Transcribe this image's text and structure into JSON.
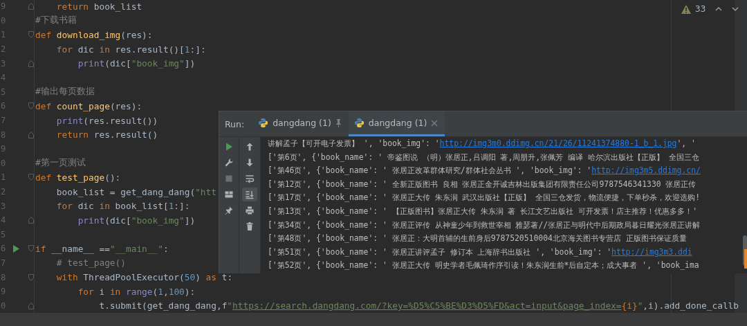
{
  "editor": {
    "lines": [
      {
        "number": "9",
        "run": false,
        "fold": {
          "kind": "end"
        },
        "tokens": [
          {
            "kind": "kw",
            "text": "    return"
          },
          {
            "kind": "p",
            "text": " book_list"
          }
        ]
      },
      {
        "number": "0",
        "run": false,
        "tokens": [
          {
            "kind": "cm",
            "text": "#下载书籍"
          }
        ]
      },
      {
        "number": "1",
        "run": false,
        "fold": {
          "kind": "start"
        },
        "tokens": [
          {
            "kind": "kw",
            "text": "def "
          },
          {
            "kind": "fn",
            "text": "download_img"
          },
          {
            "kind": "p",
            "text": "(res):"
          }
        ]
      },
      {
        "number": "2",
        "run": false,
        "tokens": [
          {
            "kind": "kw",
            "text": "    for"
          },
          {
            "kind": "p",
            "text": " dic "
          },
          {
            "kind": "kw",
            "text": "in"
          },
          {
            "kind": "p",
            "text": " res.result()["
          },
          {
            "kind": "num",
            "text": "1"
          },
          {
            "kind": "p",
            "text": ":]:"
          }
        ]
      },
      {
        "number": "3",
        "run": false,
        "fold": {
          "kind": "end"
        },
        "tokens": [
          {
            "kind": "bi",
            "text": "        print"
          },
          {
            "kind": "p",
            "text": "(dic["
          },
          {
            "kind": "str",
            "text": "\"book_img\""
          },
          {
            "kind": "p",
            "text": "])"
          }
        ]
      },
      {
        "number": "4",
        "run": false
      },
      {
        "number": "5",
        "run": false,
        "tokens": [
          {
            "kind": "cm",
            "text": "#输出每页数据"
          }
        ]
      },
      {
        "number": "6",
        "run": false,
        "fold": {
          "kind": "start"
        },
        "tokens": [
          {
            "kind": "kw",
            "text": "def "
          },
          {
            "kind": "fn",
            "text": "count_page"
          },
          {
            "kind": "p",
            "text": "(res):"
          }
        ]
      },
      {
        "number": "7",
        "run": false,
        "tokens": [
          {
            "kind": "bi",
            "text": "    print"
          },
          {
            "kind": "p",
            "text": "(res.result())"
          }
        ]
      },
      {
        "number": "8",
        "run": false,
        "fold": {
          "kind": "end"
        },
        "tokens": [
          {
            "kind": "kw",
            "text": "    return"
          },
          {
            "kind": "p",
            "text": " res.result()"
          }
        ]
      },
      {
        "number": "9",
        "run": false
      },
      {
        "number": "0",
        "run": false,
        "tokens": [
          {
            "kind": "cm",
            "text": "#第一页测试"
          }
        ]
      },
      {
        "number": "1",
        "run": false,
        "fold": {
          "kind": "start"
        },
        "tokens": [
          {
            "kind": "kw",
            "text": "def "
          },
          {
            "kind": "fn",
            "text": "test_page"
          },
          {
            "kind": "p",
            "text": "():"
          }
        ]
      },
      {
        "number": "2",
        "run": false,
        "tokens": [
          {
            "kind": "p",
            "text": "    book_list = get_dang_dang("
          },
          {
            "kind": "str",
            "text": "\"htt"
          }
        ]
      },
      {
        "number": "3",
        "run": false,
        "tokens": [
          {
            "kind": "kw",
            "text": "    for"
          },
          {
            "kind": "p",
            "text": " dic "
          },
          {
            "kind": "kw",
            "text": "in"
          },
          {
            "kind": "p",
            "text": " book_list["
          },
          {
            "kind": "num",
            "text": "1"
          },
          {
            "kind": "p",
            "text": ":]:"
          }
        ]
      },
      {
        "number": "4",
        "run": false,
        "fold": {
          "kind": "end"
        },
        "tokens": [
          {
            "kind": "bi",
            "text": "        print"
          },
          {
            "kind": "p",
            "text": "(dic["
          },
          {
            "kind": "str",
            "text": "\"book_img\""
          },
          {
            "kind": "p",
            "text": "])"
          }
        ]
      },
      {
        "number": "5",
        "run": false
      },
      {
        "number": "6",
        "run": true,
        "fold": {
          "kind": "start"
        },
        "tokens": [
          {
            "kind": "kw",
            "text": "if"
          },
          {
            "kind": "p",
            "text": " __name__ =="
          },
          {
            "kind": "str",
            "text": "\"__main__\""
          },
          {
            "kind": "p",
            "text": ":"
          }
        ]
      },
      {
        "number": "7",
        "run": false,
        "tokens": [
          {
            "kind": "cm",
            "text": "    # test_page()"
          }
        ]
      },
      {
        "number": "8",
        "run": false,
        "fold": {
          "kind": "start"
        },
        "tokens": [
          {
            "kind": "kw",
            "text": "    with"
          },
          {
            "kind": "p",
            "text": " ThreadPoolExecutor("
          },
          {
            "kind": "num",
            "text": "50"
          },
          {
            "kind": "p",
            "text": ") "
          },
          {
            "kind": "kw",
            "text": "as"
          },
          {
            "kind": "p",
            "text": " t:"
          }
        ]
      },
      {
        "number": "9",
        "run": false,
        "tokens": [
          {
            "kind": "kw",
            "text": "        for"
          },
          {
            "kind": "p",
            "text": " i "
          },
          {
            "kind": "kw",
            "text": "in"
          },
          {
            "kind": "bi",
            "text": " range"
          },
          {
            "kind": "p",
            "text": "("
          },
          {
            "kind": "num",
            "text": "1"
          },
          {
            "kind": "p",
            "text": ","
          },
          {
            "kind": "num",
            "text": "100"
          },
          {
            "kind": "p",
            "text": "):"
          }
        ]
      },
      {
        "number": "0",
        "run": false,
        "fold": {
          "kind": "end"
        },
        "tokens": [
          {
            "kind": "p",
            "text": "            t.submit(get_dang_dang,f"
          },
          {
            "kind": "str",
            "text": "\""
          },
          {
            "kind": "link",
            "text": "https://search.dangdang.com/?key=%D5%C5%BE%D3%D5%FD&act=input&page_index="
          },
          {
            "kind": "kw",
            "text": "{i}"
          },
          {
            "kind": "str",
            "text": "\""
          },
          {
            "kind": "p",
            "text": ",i).add_done_callb"
          }
        ]
      },
      {
        "run": false,
        "current": true
      }
    ]
  },
  "inspection": {
    "count": "33"
  },
  "run_panel": {
    "label": "Run:",
    "tabs": [
      {
        "label": "dangdang (1)",
        "selected": false,
        "pinned": true
      },
      {
        "label": "dangdang (1)",
        "selected": true,
        "pinned": false
      }
    ],
    "toolbar_left": [
      {
        "kind": "run",
        "disabled": false
      },
      {
        "kind": "settings",
        "disabled": false
      },
      {
        "kind": "stop",
        "disabled": true
      },
      {
        "kind": "layout",
        "disabled": false
      },
      {
        "kind": "pin",
        "disabled": false
      }
    ],
    "toolbar_right": [
      {
        "kind": "up",
        "selected": false
      },
      {
        "kind": "down",
        "selected": false
      },
      {
        "kind": "wrap",
        "selected": false
      },
      {
        "kind": "scroll-end",
        "selected": true
      },
      {
        "kind": "print",
        "selected": false
      },
      {
        "kind": "trash",
        "selected": false
      }
    ],
    "output": [
      {
        "segments": [
          {
            "kind": "text",
            "text": "讲解孟子【可开电子发票】 ', 'book_img': '"
          },
          {
            "kind": "link",
            "text": "http://img3m0.ddimg.cn/21/26/11241374880-1_b_1.jpg"
          },
          {
            "kind": "text",
            "text": "', '"
          }
        ]
      },
      {
        "segments": [
          {
            "kind": "text",
            "text": "['第6页', {'book_name': ' 帝鉴图说 （明）张居正,吕调阳 著,周朋升,张佩芳 编译 哈尔滨出版社【正版】 全国三仓"
          }
        ]
      },
      {
        "segments": [
          {
            "kind": "text",
            "text": "['第46页', {'book_name': ' 张居正改革群体研究/群体社会丛书 ', 'book_img': '"
          },
          {
            "kind": "link",
            "text": "http://img3m5.ddimg.cn/"
          }
        ]
      },
      {
        "segments": [
          {
            "kind": "text",
            "text": "['第12页', {'book_name': ' 全新正版图书 良相 张居正金开诚吉林出版集团有限责任公司9787546341330 张居正传"
          }
        ]
      },
      {
        "segments": [
          {
            "kind": "text",
            "text": "['第17页', {'book_name': ' 张居正大传 朱东润 武汉出版社【正版】 全国三仓发货，物流便捷，下单秒杀，欢迎选购!"
          }
        ]
      },
      {
        "segments": [
          {
            "kind": "text",
            "text": "['第13页', {'book_name': ' 【正版图书】张居正大传 朱东润 著 长江文艺出版社 可开发票！店主推荐！优惠多多！'"
          }
        ]
      },
      {
        "segments": [
          {
            "kind": "text",
            "text": "['第34页', {'book_name': ' 张居正评传 从神童少年到救世宰相 雅瑟著//张居正与明代中后期政局暮日耀光张居正讲解"
          }
        ]
      },
      {
        "segments": [
          {
            "kind": "text",
            "text": "['第48页', {'book_name': ' 张居正：大明首辅的生前身后9787520510004北京海关图书专营店 正版图书保证质量"
          }
        ]
      },
      {
        "segments": [
          {
            "kind": "text",
            "text": "['第51页', {'book_name': ' 张居正讲评孟子 修订本 上海辞书出版社 ', 'book_img': '"
          },
          {
            "kind": "link",
            "text": "http://img3m3.ddi"
          }
        ]
      },
      {
        "segments": [
          {
            "kind": "text",
            "text": "['第52页', {'book_name': ' 张居正大传 明史学者毛佩琦作序引读！朱东润生前*后自定本；成大事者 ', 'book_ima"
          }
        ]
      }
    ]
  }
}
